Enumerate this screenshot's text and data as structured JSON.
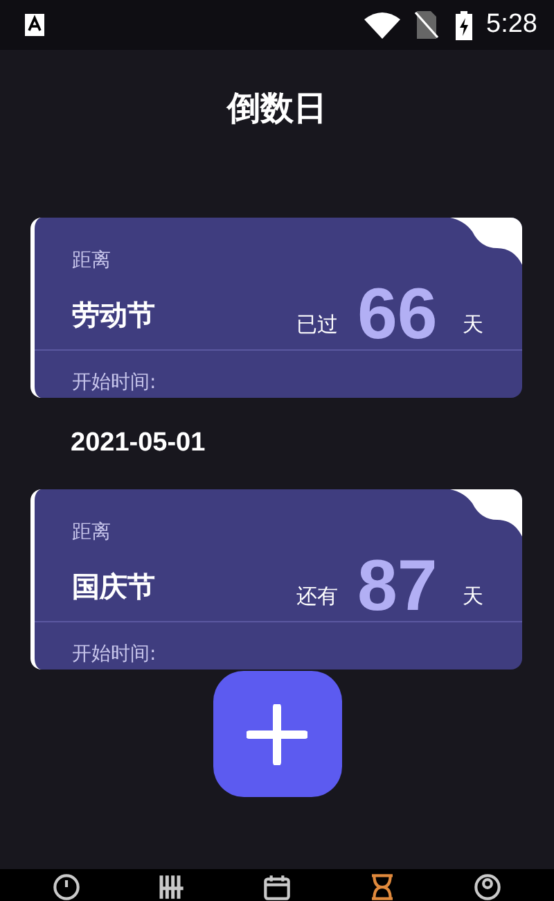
{
  "status_bar": {
    "time": "5:28"
  },
  "title": "倒数日",
  "events": [
    {
      "label": "距离",
      "name": "劳动节",
      "relation": "已过",
      "days": "66",
      "unit": "天",
      "start_label": "开始时间:",
      "date": "2021-05-01"
    },
    {
      "label": "距离",
      "name": "国庆节",
      "relation": "还有",
      "days": "87",
      "unit": "天",
      "start_label": "开始时间:"
    }
  ],
  "nav": [
    {
      "kind": "clock",
      "selected": false
    },
    {
      "kind": "bars",
      "selected": false
    },
    {
      "kind": "calendar",
      "selected": false
    },
    {
      "kind": "hourglass",
      "selected": true
    },
    {
      "kind": "person",
      "selected": false
    }
  ]
}
